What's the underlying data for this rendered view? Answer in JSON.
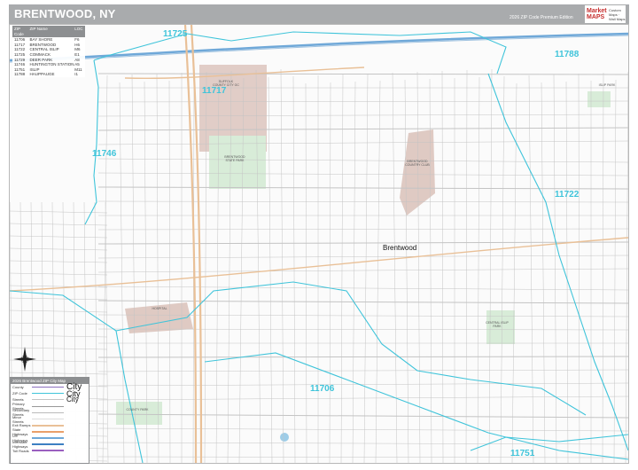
{
  "title": "BRENTWOOD, NY",
  "edition": "2026 ZIP Code Premium Edition",
  "logo": {
    "brand": "Market MAPS",
    "sub": "Custom Maps · Wall Maps"
  },
  "zip_table": {
    "headers": [
      "ZIP Code",
      "ZIP Name",
      "LOC"
    ],
    "rows": [
      [
        "11706",
        "BAY SHORE",
        "F6"
      ],
      [
        "11717",
        "BRENTWOOD",
        "H6"
      ],
      [
        "11722",
        "CENTRAL ISLIP",
        "M6"
      ],
      [
        "11725",
        "COMMACK",
        "E1"
      ],
      [
        "11729",
        "DEER PARK",
        "A8"
      ],
      [
        "11746",
        "HUNTINGTON STATION",
        "A5"
      ],
      [
        "11751",
        "ISLIP",
        "M11"
      ],
      [
        "11788",
        "HAUPPAUGE",
        "I1"
      ]
    ]
  },
  "zip_labels": [
    "11725",
    "11788",
    "11717",
    "11746",
    "11722",
    "11706",
    "11751"
  ],
  "town_label": "Brentwood",
  "pois": [
    "SUFFOLK COUNTY CITY GC",
    "BRENTWOOD STATE PARK",
    "BRENTWOOD COUNTRY CLUB",
    "HOSPITAL",
    "CENTRAL ISLIP PARK",
    "COUNTY PARK",
    "ISLIP PARK",
    "STATE PARK"
  ],
  "legend": {
    "heading": "2026 Brentwood ZIP City Map",
    "items": [
      "County",
      "ZIP Code",
      "Streets",
      "Primary Streets",
      "Secondary Streets",
      "Minor Streets",
      "Exit Ramps",
      "State Highways",
      "US Highways",
      "Interstate Highways",
      "Toll Roads"
    ],
    "city_samples": [
      "City",
      "City",
      "City"
    ]
  },
  "colors": {
    "zip_boundary": "#3fc4da",
    "park": "#d8ecd8",
    "institution": "#dcc4bd",
    "interstate": "#6fa8d8",
    "state_hwy": "#e9c097",
    "street": "#c4c4c4"
  }
}
